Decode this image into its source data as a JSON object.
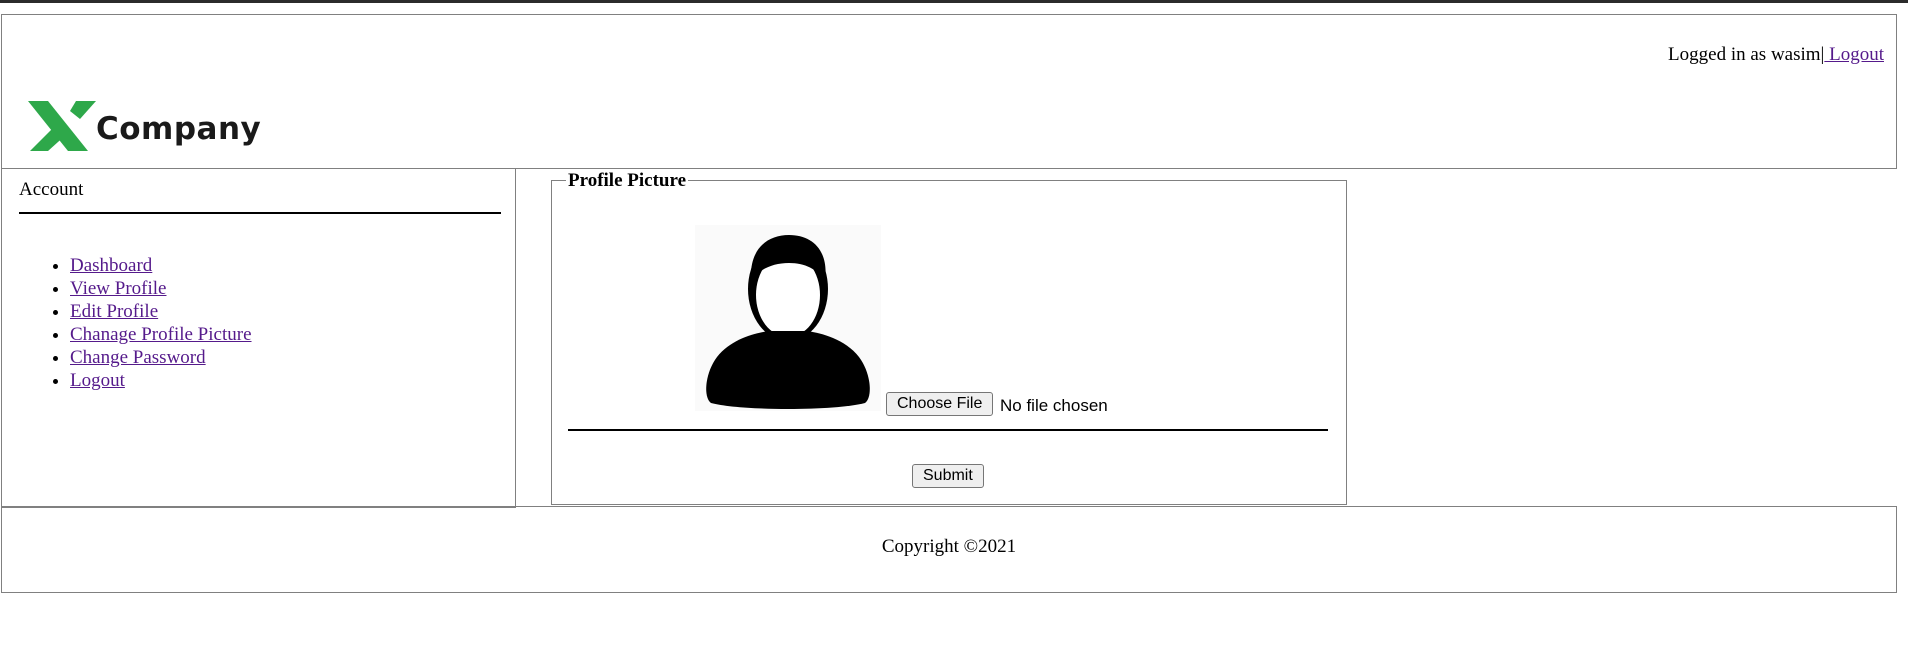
{
  "header": {
    "logo_text": "Company",
    "login_prefix": "Logged in as wasim|",
    "logout_link": " Logout"
  },
  "sidebar": {
    "title": "Account",
    "items": [
      {
        "label": "Dashboard"
      },
      {
        "label": "View Profile"
      },
      {
        "label": "Edit Profile"
      },
      {
        "label": "Chanage Profile Picture"
      },
      {
        "label": "Change Password"
      },
      {
        "label": "Logout"
      }
    ]
  },
  "form": {
    "legend": "Profile Picture",
    "file_button": "Choose File",
    "file_status": "No file chosen",
    "submit": "Submit"
  },
  "footer": {
    "copyright": "Copyright ©2021"
  },
  "colors": {
    "logo_green": "#2ea84a",
    "link": "#551a8b"
  },
  "icons": {
    "logo": "x-logo-icon",
    "avatar": "user-avatar-icon"
  }
}
